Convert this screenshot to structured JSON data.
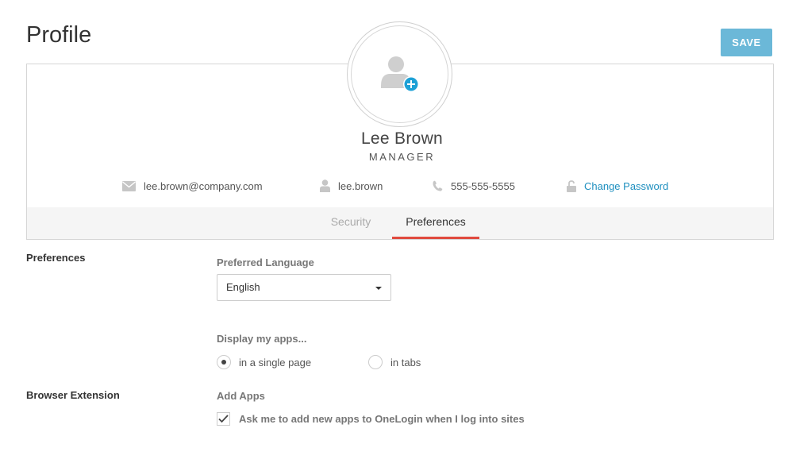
{
  "header": {
    "title": "Profile",
    "save_label": "SAVE"
  },
  "profile": {
    "name": "Lee Brown",
    "role": "MANAGER",
    "email": "lee.brown@company.com",
    "username": "lee.brown",
    "phone": "555-555-5555",
    "change_password_label": "Change Password",
    "avatar_icon": "add-user-icon"
  },
  "tabs": [
    {
      "label": "Security",
      "active": false
    },
    {
      "label": "Preferences",
      "active": true
    }
  ],
  "preferences": {
    "section_label": "Preferences",
    "language_label": "Preferred Language",
    "language_value": "English",
    "display_label": "Display my apps...",
    "display_options": [
      {
        "label": "in a single page",
        "selected": true
      },
      {
        "label": "in tabs",
        "selected": false
      }
    ]
  },
  "browser_extension": {
    "section_label": "Browser Extension",
    "add_apps_label": "Add Apps",
    "checkbox_label": "Ask me to add new apps to OneLogin when I log into sites",
    "checked": true
  },
  "colors": {
    "save_button": "#6bb8d8",
    "link": "#1e8fbf",
    "active_tab_underline": "#e04a3e",
    "avatar_plus": "#1ea1d6"
  }
}
